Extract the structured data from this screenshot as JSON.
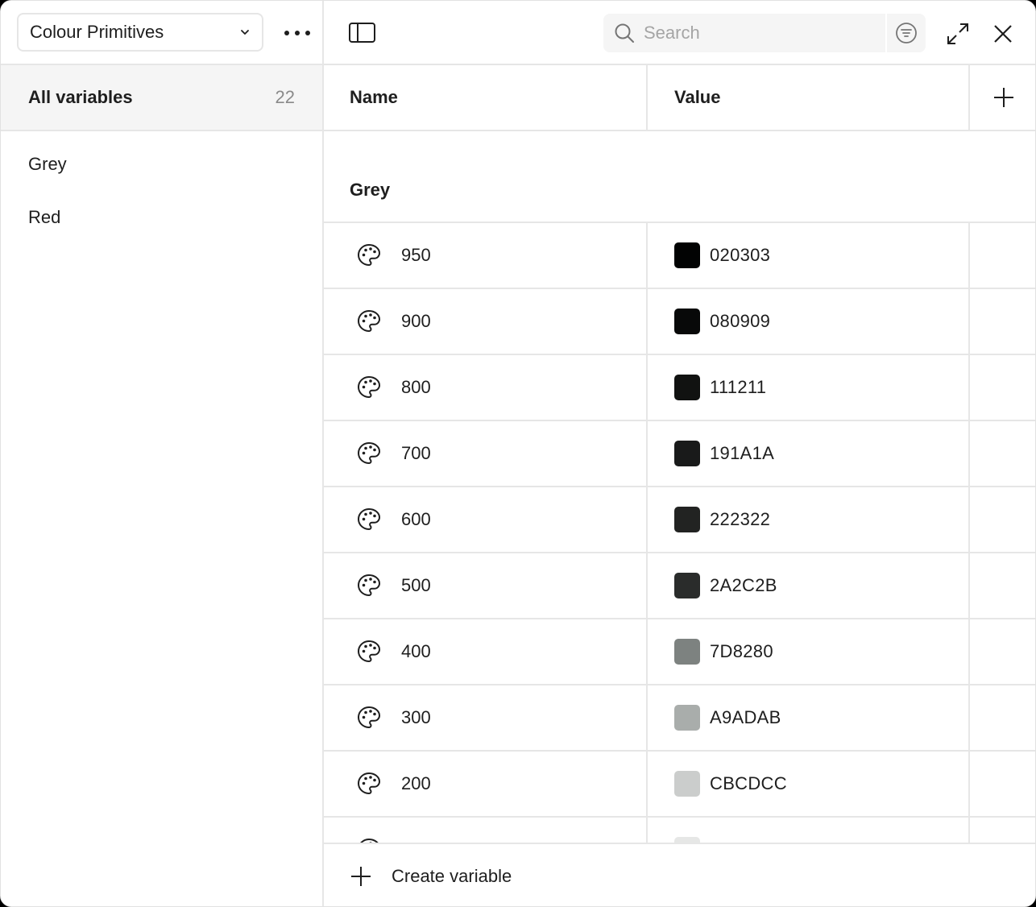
{
  "sidebar": {
    "collection": "Colour Primitives",
    "all_variables_label": "All variables",
    "all_variables_count": "22",
    "groups": [
      {
        "label": "Grey"
      },
      {
        "label": "Red"
      }
    ]
  },
  "toolbar": {
    "search_placeholder": "Search"
  },
  "table": {
    "columns": [
      "Name",
      "Value"
    ],
    "group_title": "Grey",
    "rows": [
      {
        "name": "950",
        "value": "020303",
        "color": "#020303"
      },
      {
        "name": "900",
        "value": "080909",
        "color": "#080909"
      },
      {
        "name": "800",
        "value": "111211",
        "color": "#111211"
      },
      {
        "name": "700",
        "value": "191A1A",
        "color": "#191A1A"
      },
      {
        "name": "600",
        "value": "222322",
        "color": "#222322"
      },
      {
        "name": "500",
        "value": "2A2C2B",
        "color": "#2A2C2B"
      },
      {
        "name": "400",
        "value": "7D8280",
        "color": "#7D8280"
      },
      {
        "name": "300",
        "value": "A9ADAB",
        "color": "#A9ADAB"
      },
      {
        "name": "200",
        "value": "CBCDCC",
        "color": "#CBCDCC"
      },
      {
        "name": "",
        "value": "",
        "color": "#E6E7E6"
      }
    ]
  },
  "footer": {
    "create_label": "Create variable"
  },
  "icons": {
    "collection_chevron": "chevron-down-icon",
    "more": "more-horizontal-icon",
    "panel": "sidebar-toggle-icon",
    "search": "search-icon",
    "filter": "filter-icon",
    "expand": "expand-icon",
    "close": "close-icon",
    "add": "plus-icon",
    "variable": "palette-icon"
  }
}
